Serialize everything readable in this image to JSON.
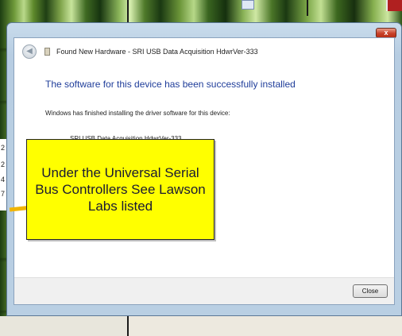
{
  "background": {
    "fragment_numbers": [
      "2",
      "2",
      "4",
      "7"
    ]
  },
  "dialog": {
    "title": "Found New Hardware - SRI USB Data Acquisition HdwrVer-333",
    "heading": "The software for this device has been successfully installed",
    "body": "Windows has finished installing the driver software for this device:",
    "device_name": "SRI USB Data Acquisition HdwrVer-333",
    "close_button": "Close",
    "close_glyph": "x"
  },
  "callout": {
    "text": "Under the Universal Serial Bus Controllers See Lawson Labs listed"
  },
  "colors": {
    "heading": "#1f3d9a",
    "callout_fill": "#ffff00",
    "callout_pointer": "#f0b400",
    "titlebar_close": "#c8412a"
  }
}
